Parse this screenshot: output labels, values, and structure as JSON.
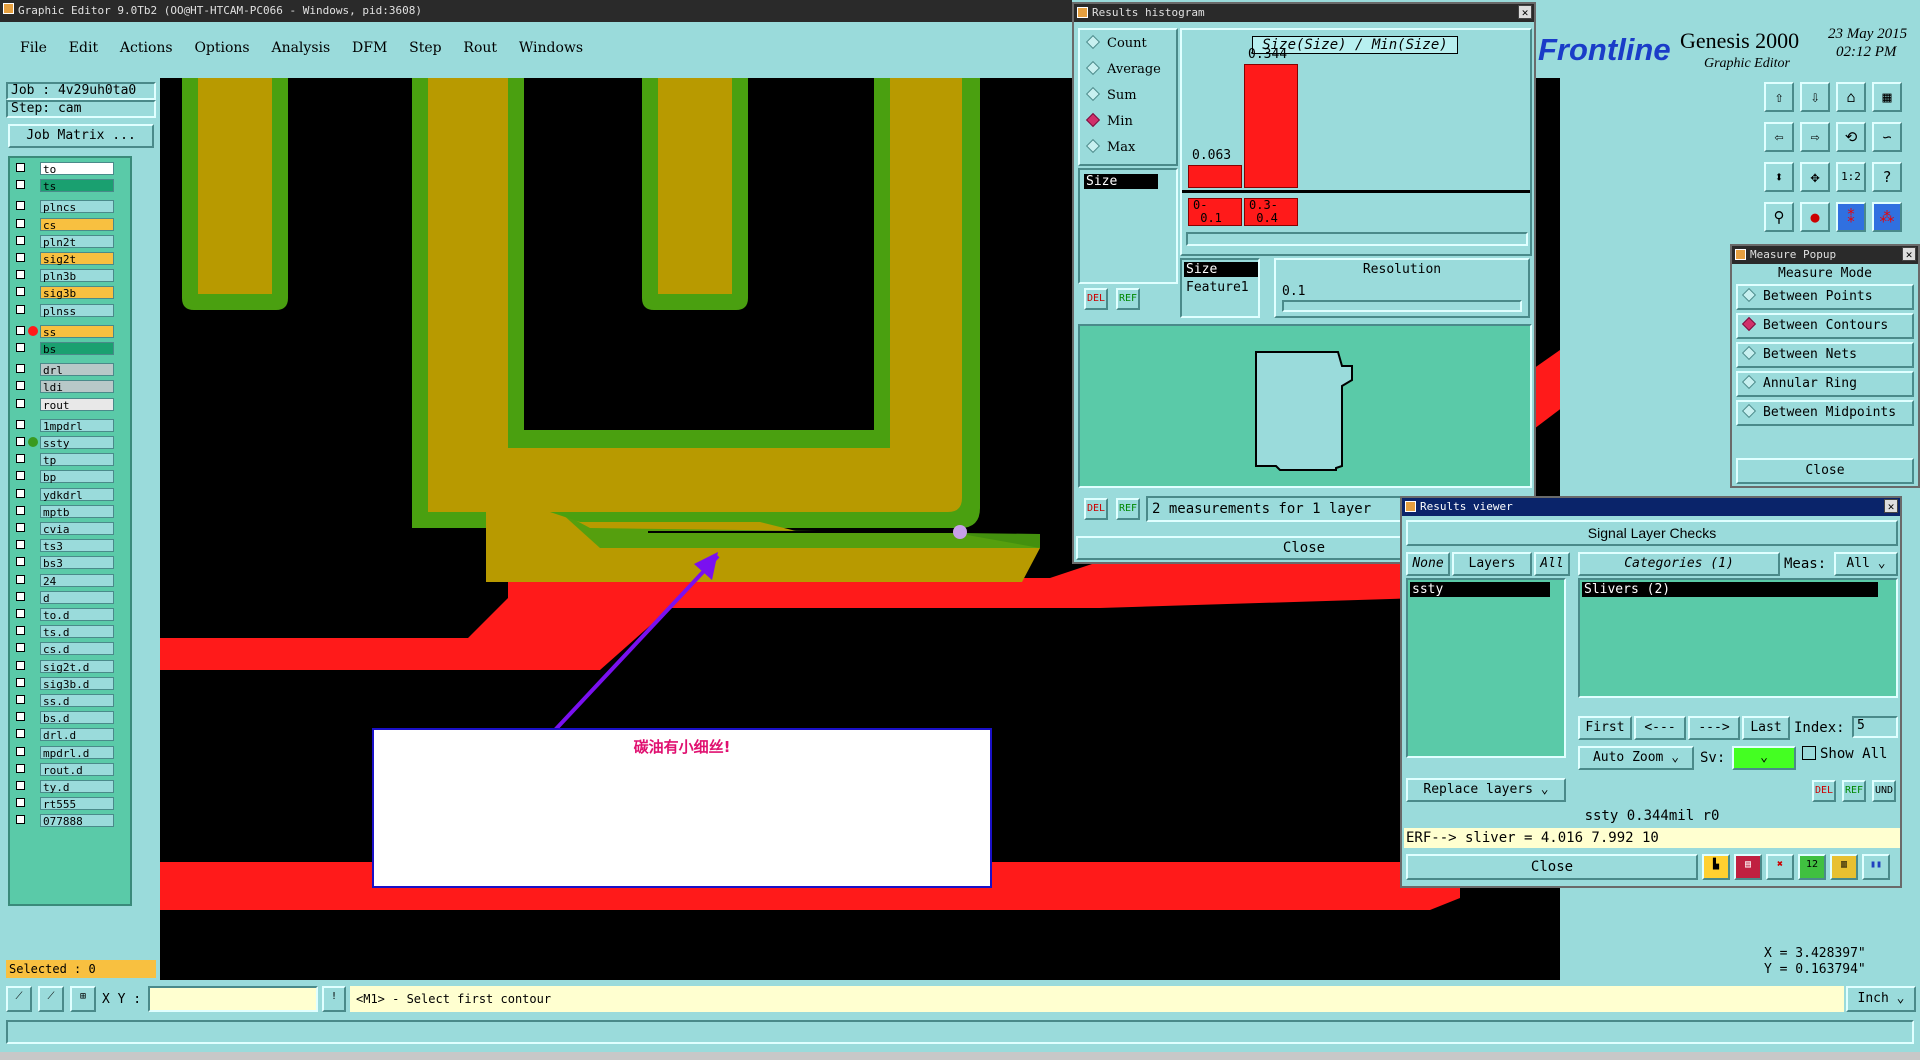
{
  "main": {
    "title": "Graphic Editor 9.0Tb2 (OO@HT-HTCAM-PC066 - Windows, pid:3608)",
    "menu": [
      "File",
      "Edit",
      "Actions",
      "Options",
      "Analysis",
      "DFM",
      "Step",
      "Rout",
      "Windows"
    ],
    "job_label": "Job : 4v29uh0ta0",
    "step_label": "Step: cam",
    "job_matrix": "Job Matrix ...",
    "selected": "Selected : 0",
    "xy_label": "X Y :",
    "prompt": "<M1> - Select first contour",
    "units": "Inch",
    "coord_x": "X = 3.428397\"",
    "coord_y": "Y = 0.163794\""
  },
  "layers": [
    {
      "name": "to",
      "color": "#ffffff"
    },
    {
      "name": "ts",
      "color": "#1aa070"
    },
    {
      "name": "plncs",
      "color": "#9adbdb"
    },
    {
      "name": "cs",
      "color": "#f8c040"
    },
    {
      "name": "pln2t",
      "color": "#9adbdb"
    },
    {
      "name": "sig2t",
      "color": "#f8c040"
    },
    {
      "name": "pln3b",
      "color": "#9adbdb"
    },
    {
      "name": "sig3b",
      "color": "#f8c040"
    },
    {
      "name": "plnss",
      "color": "#9adbdb"
    },
    {
      "name": "ss",
      "color": "#f8c040"
    },
    {
      "name": "bs",
      "color": "#1aa070"
    },
    {
      "name": "drl",
      "color": "#b8c8c8"
    },
    {
      "name": "ldi",
      "color": "#b8c8c8"
    },
    {
      "name": "rout",
      "color": "#e8e8e8"
    },
    {
      "name": "1mpdrl",
      "color": "#9adbdb"
    },
    {
      "name": "ssty",
      "color": "#9adbdb"
    },
    {
      "name": "tp",
      "color": "#9adbdb"
    },
    {
      "name": "bp",
      "color": "#9adbdb"
    },
    {
      "name": "ydkdrl",
      "color": "#9adbdb"
    },
    {
      "name": "mptb",
      "color": "#9adbdb"
    },
    {
      "name": "cvia",
      "color": "#9adbdb"
    },
    {
      "name": "ts3",
      "color": "#9adbdb"
    },
    {
      "name": "bs3",
      "color": "#9adbdb"
    },
    {
      "name": "24",
      "color": "#9adbdb"
    },
    {
      "name": "d",
      "color": "#9adbdb"
    },
    {
      "name": "to.d",
      "color": "#9adbdb"
    },
    {
      "name": "ts.d",
      "color": "#9adbdb"
    },
    {
      "name": "cs.d",
      "color": "#9adbdb"
    },
    {
      "name": "sig2t.d",
      "color": "#9adbdb"
    },
    {
      "name": "sig3b.d",
      "color": "#9adbdb"
    },
    {
      "name": "ss.d",
      "color": "#9adbdb"
    },
    {
      "name": "bs.d",
      "color": "#9adbdb"
    },
    {
      "name": "drl.d",
      "color": "#9adbdb"
    },
    {
      "name": "mpdrl.d",
      "color": "#9adbdb"
    },
    {
      "name": "rout.d",
      "color": "#9adbdb"
    },
    {
      "name": "ty.d",
      "color": "#9adbdb"
    },
    {
      "name": "rt555",
      "color": "#9adbdb"
    },
    {
      "name": "077888",
      "color": "#9adbdb"
    }
  ],
  "annotation": "碳油有小细丝!",
  "histogram": {
    "title": "Results histogram",
    "options": [
      "Count",
      "Average",
      "Sum",
      "Min",
      "Max"
    ],
    "selected_option": "Min",
    "formula": "Size(Size) / Min(Size)",
    "bars": [
      {
        "label": "0-\n 0.1",
        "value": 0.063
      },
      {
        "label": "0.3-\n 0.4",
        "value": 0.344
      }
    ],
    "bar_top_labels": [
      "0.063",
      "0.344"
    ],
    "list_item": "Size",
    "size_items": [
      "Size",
      "Feature1"
    ],
    "resolution_label": "Resolution",
    "resolution_value": "0.1",
    "measurements": "2 measurements for 1 layer",
    "close": "Close"
  },
  "brand": {
    "logo": "Frontline",
    "product": "Genesis 2000",
    "subtitle": "Graphic Editor",
    "date": "23 May 2015",
    "time": "02:12 PM"
  },
  "measure": {
    "title": "Measure Popup",
    "mode_label": "Measure Mode",
    "options": [
      "Between Points",
      "Between Contours",
      "Between Nets",
      "Annular Ring",
      "Between Midpoints"
    ],
    "selected": "Between Contours",
    "close": "Close"
  },
  "viewer": {
    "title": "Results viewer",
    "header": "Signal Layer Checks",
    "none": "None",
    "layers": "Layers",
    "all": "All",
    "categories": "Categories (1)",
    "meas_label": "Meas:",
    "meas_value": "All",
    "layer_item": "ssty",
    "category_item": "Slivers (2)",
    "first": "First",
    "prev": "<---",
    "next": "--->",
    "last": "Last",
    "index_label": "Index:",
    "index_value": "5",
    "auto_zoom": "Auto Zoom",
    "sv_label": "Sv:",
    "show_all": "Show All",
    "replace_layers": "Replace layers",
    "status": "ssty 0.344mil  r0",
    "erf": "ERF--> sliver = 4.016 7.992 10",
    "close": "Close"
  },
  "colors": {
    "canvas": "#000000",
    "copper": "#ff1a1a",
    "mask": "#4aa010",
    "ink": "#b89a00",
    "panel": "#9adbdb"
  }
}
